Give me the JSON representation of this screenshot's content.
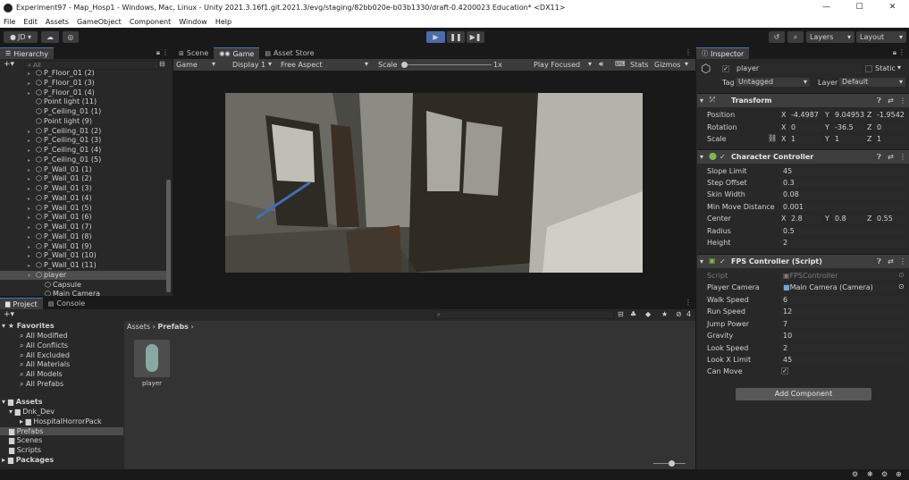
{
  "window": {
    "title": "Experiment97 - Map_Hosp1 - Windows, Mac, Linux - Unity 2021.3.16f1.git.2021.3/evg/staging/82bb020e-b03b1330/draft-0.4200023 Education* <DX11>",
    "minimize": "—",
    "maximize": "☐",
    "close": "✕"
  },
  "menu": [
    "File",
    "Edit",
    "Assets",
    "GameObject",
    "Component",
    "Window",
    "Help"
  ],
  "toolbar": {
    "account": "JD ▾",
    "layers": "Layers",
    "layout": "Layout"
  },
  "hierarchy": {
    "tab": "Hierarchy",
    "search_placeholder": "All",
    "items": [
      {
        "label": "P_Floor_01 (2)",
        "arrow": true,
        "indent": 0
      },
      {
        "label": "P_Floor_01 (3)",
        "arrow": true,
        "indent": 0
      },
      {
        "label": "P_Floor_01 (4)",
        "arrow": true,
        "indent": 0
      },
      {
        "label": "Point light (11)",
        "arrow": false,
        "indent": 0
      },
      {
        "label": "P_Ceiling_01 (1)",
        "arrow": false,
        "indent": 0
      },
      {
        "label": "Point light (9)",
        "arrow": false,
        "indent": 0
      },
      {
        "label": "P_Ceiling_01 (2)",
        "arrow": true,
        "indent": 0
      },
      {
        "label": "P_Ceiling_01 (3)",
        "arrow": true,
        "indent": 0
      },
      {
        "label": "P_Ceiling_01 (4)",
        "arrow": true,
        "indent": 0
      },
      {
        "label": "P_Ceiling_01 (5)",
        "arrow": true,
        "indent": 0
      },
      {
        "label": "P_Wall_01 (1)",
        "arrow": true,
        "indent": 0
      },
      {
        "label": "P_Wall_01 (2)",
        "arrow": true,
        "indent": 0
      },
      {
        "label": "P_Wall_01 (3)",
        "arrow": true,
        "indent": 0
      },
      {
        "label": "P_Wall_01 (4)",
        "arrow": true,
        "indent": 0
      },
      {
        "label": "P_Wall_01 (5)",
        "arrow": true,
        "indent": 0
      },
      {
        "label": "P_Wall_01 (6)",
        "arrow": true,
        "indent": 0
      },
      {
        "label": "P_Wall_01 (7)",
        "arrow": true,
        "indent": 0
      },
      {
        "label": "P_Wall_01 (8)",
        "arrow": true,
        "indent": 0
      },
      {
        "label": "P_Wall_01 (9)",
        "arrow": true,
        "indent": 0
      },
      {
        "label": "P_Wall_01 (10)",
        "arrow": true,
        "indent": 0
      },
      {
        "label": "P_Wall_01 (11)",
        "arrow": true,
        "indent": 0
      },
      {
        "label": "player",
        "arrow": true,
        "indent": 0,
        "selected": true
      },
      {
        "label": "Capsule",
        "arrow": false,
        "indent": 1
      },
      {
        "label": "Main Camera",
        "arrow": false,
        "indent": 1
      }
    ]
  },
  "scene_tabs": {
    "scene": "Scene",
    "game": "Game",
    "asset_store": "Asset Store"
  },
  "game_toolbar": {
    "mode": "Game",
    "display": "Display 1",
    "aspect": "Free Aspect",
    "scale_label": "Scale",
    "scale_value": "1x",
    "play_focused": "Play Focused",
    "stats": "Stats",
    "gizmos": "Gizmos"
  },
  "project": {
    "tab_project": "Project",
    "tab_console": "Console",
    "favorites_label": "Favorites",
    "favorites": [
      "All Modified",
      "All Conflicts",
      "All Excluded",
      "All Materials",
      "All Models",
      "All Prefabs"
    ],
    "assets_label": "Assets",
    "asset_tree": [
      {
        "label": "Dnk_Dev",
        "indent": 1
      },
      {
        "label": "HospitalHorrorPack",
        "indent": 2
      },
      {
        "label": "Prefabs",
        "indent": 1,
        "selected": true
      },
      {
        "label": "Scenes",
        "indent": 1
      },
      {
        "label": "Scripts",
        "indent": 1
      }
    ],
    "packages_label": "Packages",
    "breadcrumb_root": "Assets",
    "breadcrumb_current": "Prefabs",
    "hidden_count": "4",
    "asset_item": "player"
  },
  "inspector": {
    "tab": "Inspector",
    "object_name": "player",
    "static_label": "Static",
    "tag_label": "Tag",
    "tag_value": "Untagged",
    "layer_label": "Layer",
    "layer_value": "Default",
    "transform": {
      "title": "Transform",
      "position_label": "Position",
      "rotation_label": "Rotation",
      "scale_label": "Scale",
      "position": {
        "x": "-4.4987",
        "y": "9.04953",
        "z": "-1.9542"
      },
      "rotation": {
        "x": "0",
        "y": "-36.5",
        "z": "0"
      },
      "scale": {
        "x": "1",
        "y": "1",
        "z": "1"
      }
    },
    "character_controller": {
      "title": "Character Controller",
      "rows": [
        {
          "label": "Slope Limit",
          "value": "45"
        },
        {
          "label": "Step Offset",
          "value": "0.3"
        },
        {
          "label": "Skin Width",
          "value": "0.08"
        },
        {
          "label": "Min Move Distance",
          "value": "0.001"
        }
      ],
      "center_label": "Center",
      "center": {
        "x": "2.8",
        "y": "0.8",
        "z": "0.55"
      },
      "radius_label": "Radius",
      "radius": "0.5",
      "height_label": "Height",
      "height": "2"
    },
    "fps_controller": {
      "title": "FPS Controller (Script)",
      "script_label": "Script",
      "script_value": "FPSController",
      "camera_label": "Player Camera",
      "camera_value": "Main Camera (Camera)",
      "rows": [
        {
          "label": "Walk Speed",
          "value": "6"
        },
        {
          "label": "Run Speed",
          "value": "12"
        },
        {
          "label": "Jump Power",
          "value": "7"
        },
        {
          "label": "Gravity",
          "value": "10"
        },
        {
          "label": "Look Speed",
          "value": "2"
        },
        {
          "label": "Look X Limit",
          "value": "45"
        }
      ],
      "can_move_label": "Can Move"
    },
    "add_component": "Add Component"
  },
  "colors": {
    "accent": "#3a79bb",
    "play_active": "#4c6ca8",
    "panel_bg": "#282828",
    "header_bg": "#3e3e3e"
  }
}
